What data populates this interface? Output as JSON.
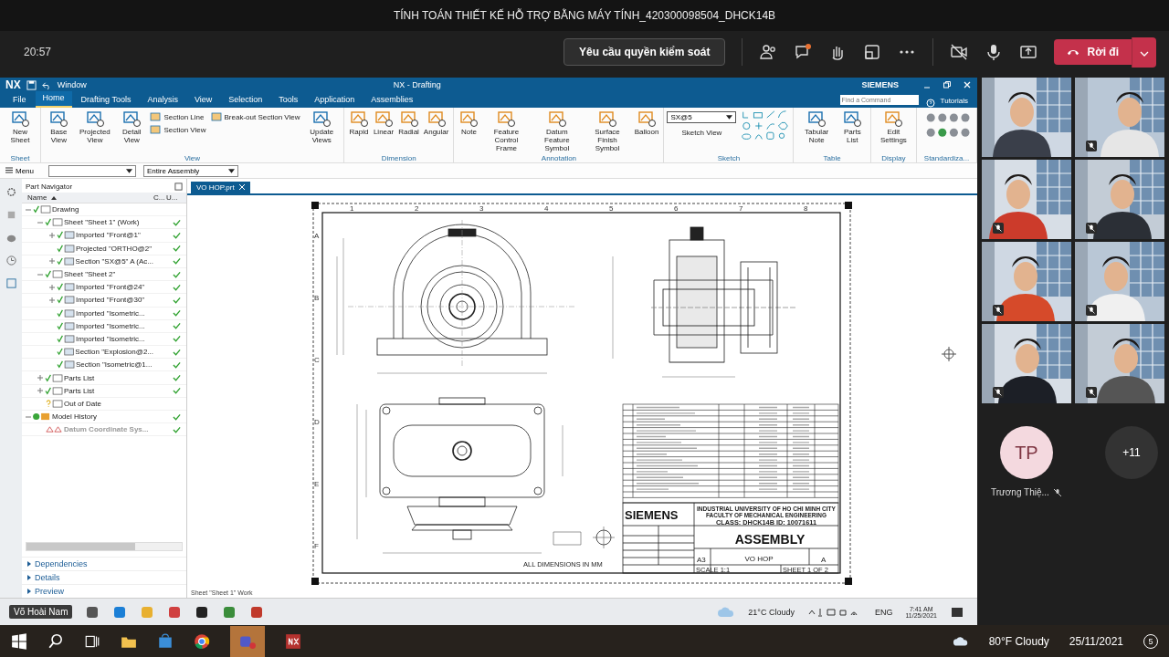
{
  "meeting": {
    "title": "TÍNH TOÁN THIẾT KẾ HỖ TRỢ BẰNG MÁY TÍNH_420300098504_DHCK14B",
    "time": "20:57",
    "control_request": "Yêu cầu quyền kiểm soát",
    "leave": "Rời đi",
    "chat_unread": true
  },
  "nx": {
    "brand": "NX",
    "quick_menu": "Window",
    "title": "NX - Drafting",
    "vendor": "SIEMENS",
    "search": {
      "placeholder": "Find a Command"
    },
    "tutorials": "Tutorials",
    "tabs": [
      {
        "label": "File",
        "selected": false
      },
      {
        "label": "Home",
        "selected": true
      },
      {
        "label": "Drafting Tools",
        "selected": false
      },
      {
        "label": "Analysis",
        "selected": false
      },
      {
        "label": "View",
        "selected": false
      },
      {
        "label": "Selection",
        "selected": false
      },
      {
        "label": "Tools",
        "selected": false
      },
      {
        "label": "Application",
        "selected": false
      },
      {
        "label": "Assemblies",
        "selected": false
      }
    ],
    "ribbon": [
      {
        "label": "Sheet",
        "items": [
          {
            "label": "New Sheet",
            "kind": "large"
          }
        ]
      },
      {
        "label": "View",
        "items": [
          {
            "label": "Base View",
            "kind": "large"
          },
          {
            "label": "Projected View",
            "kind": "large"
          },
          {
            "label": "Detail View",
            "kind": "large"
          },
          {
            "label": "Section Line",
            "kind": "small"
          },
          {
            "label": "Section View",
            "kind": "small"
          },
          {
            "label": "Break-out Section View",
            "kind": "small"
          },
          {
            "label": "Update Views",
            "kind": "large"
          }
        ]
      },
      {
        "label": "Dimension",
        "items": [
          {
            "label": "Rapid",
            "kind": "large"
          },
          {
            "label": "Linear",
            "kind": "large"
          },
          {
            "label": "Radial",
            "kind": "large"
          },
          {
            "label": "Angular",
            "kind": "large"
          }
        ]
      },
      {
        "label": "Annotation",
        "items": [
          {
            "label": "Note",
            "kind": "large"
          },
          {
            "label": "Feature Control Frame",
            "kind": "large"
          },
          {
            "label": "Datum Feature Symbol",
            "kind": "large"
          },
          {
            "label": "Surface Finish Symbol",
            "kind": "large"
          },
          {
            "label": "Balloon",
            "kind": "large"
          }
        ]
      },
      {
        "label": "Sketch",
        "items": [
          {
            "label": "SX@5",
            "kind": "dropdown"
          },
          {
            "label": "Sketch View",
            "kind": "caption"
          }
        ]
      },
      {
        "label": "Table",
        "items": [
          {
            "label": "Tabular Note",
            "kind": "large"
          },
          {
            "label": "Parts List",
            "kind": "large"
          }
        ]
      },
      {
        "label": "Display",
        "items": [
          {
            "label": "Edit Settings",
            "kind": "large"
          }
        ]
      },
      {
        "label": "Standardiza..."
      }
    ],
    "menu": "Menu",
    "scope": "Entire Assembly",
    "navigator": {
      "title": "Part Navigator",
      "columns": [
        "Name",
        "C...",
        "U..."
      ],
      "tree": [
        {
          "label": "Drawing",
          "kind": "drawing",
          "expanded": true,
          "up_to_date": false,
          "disabled": false,
          "children": [
            {
              "label": "Sheet \"Sheet 1\" (Work)",
              "kind": "sheet",
              "expanded": true,
              "up_to_date": true,
              "disabled": false,
              "children": [
                {
                  "label": "Imported \"Front@1\"",
                  "kind": "view",
                  "expanded": false,
                  "up_to_date": true,
                  "disabled": false
                },
                {
                  "label": "Projected \"ORTHO@2\"",
                  "kind": "view",
                  "up_to_date": true,
                  "disabled": false
                },
                {
                  "label": "Section \"SX@5\" A (Ac...",
                  "kind": "view",
                  "expanded": false,
                  "up_to_date": true,
                  "disabled": false
                }
              ]
            },
            {
              "label": "Sheet \"Sheet 2\"",
              "kind": "sheet",
              "expanded": true,
              "up_to_date": true,
              "disabled": false,
              "children": [
                {
                  "label": "Imported \"Front@24\"",
                  "kind": "view",
                  "expanded": false,
                  "up_to_date": true,
                  "disabled": false
                },
                {
                  "label": "Imported \"Front@30\"",
                  "kind": "view",
                  "expanded": false,
                  "up_to_date": true,
                  "disabled": false
                },
                {
                  "label": "Imported \"Isometric...",
                  "kind": "view",
                  "up_to_date": true,
                  "disabled": false
                },
                {
                  "label": "Imported \"Isometric...",
                  "kind": "view",
                  "up_to_date": true,
                  "disabled": false
                },
                {
                  "label": "Imported \"Isometric...",
                  "kind": "view",
                  "up_to_date": true,
                  "disabled": false
                },
                {
                  "label": "Section \"Explosion@2...",
                  "kind": "view",
                  "up_to_date": true,
                  "disabled": false
                },
                {
                  "label": "Section \"Isometric@1...",
                  "kind": "view",
                  "up_to_date": true,
                  "disabled": false
                }
              ]
            },
            {
              "label": "Parts List",
              "kind": "table",
              "expanded": false,
              "up_to_date": true,
              "disabled": false
            },
            {
              "label": "Parts List",
              "kind": "table",
              "expanded": false,
              "up_to_date": true,
              "disabled": false
            },
            {
              "label": "Out of Date",
              "kind": "folder",
              "up_to_date": false,
              "disabled": false
            }
          ]
        },
        {
          "label": "Model History",
          "kind": "history",
          "expanded": true,
          "up_to_date": true,
          "disabled": false,
          "children": [
            {
              "label": "Datum Coordinate Sys...",
              "kind": "datum",
              "up_to_date": true,
              "disabled": true
            }
          ]
        }
      ]
    },
    "panels": [
      "Dependencies",
      "Details",
      "Preview"
    ],
    "file_tab": "VO HOP.prt",
    "status": "Sheet \"Sheet 1\" Work",
    "sheet": {
      "columns": [
        "1",
        "2",
        "3",
        "4",
        "5",
        "6",
        "7",
        "8"
      ],
      "rows": [
        "A",
        "B",
        "C",
        "D",
        "E",
        "F"
      ],
      "company": "SIEMENS",
      "school": [
        "INDUSTRIAL UNIVERSITY OF HO CHI MINH CITY",
        "FACULTY OF MECHANICAL ENGINEERING",
        "CLASS: DHCK14B     ID: 10071611"
      ],
      "title": "ASSEMBLY",
      "size": "A3",
      "drawing_no": "VO HOP",
      "rev": "A",
      "scale": "SCALE 1:1",
      "sheet_no": "SHEET 1 OF 2",
      "note": "ALL DIMENSIONS IN MM"
    }
  },
  "presenter": "Võ Hoài Nam",
  "desktop_tray": {
    "weather": "21°C Cloudy",
    "lang": "ENG",
    "time": "7:41 AM",
    "date": "11/25/2021"
  },
  "participants": [
    {
      "muted": false
    },
    {
      "muted": true
    },
    {
      "muted": true
    },
    {
      "muted": true
    },
    {
      "muted": true
    },
    {
      "muted": true
    },
    {
      "muted": true
    },
    {
      "muted": true
    }
  ],
  "avatar": {
    "initials": "TP",
    "name": "Trương Thiệ...",
    "muted": true
  },
  "more": "+11",
  "taskbar": {
    "weather": "80°F Cloudy",
    "date": "25/11/2021",
    "notifications": "5"
  }
}
